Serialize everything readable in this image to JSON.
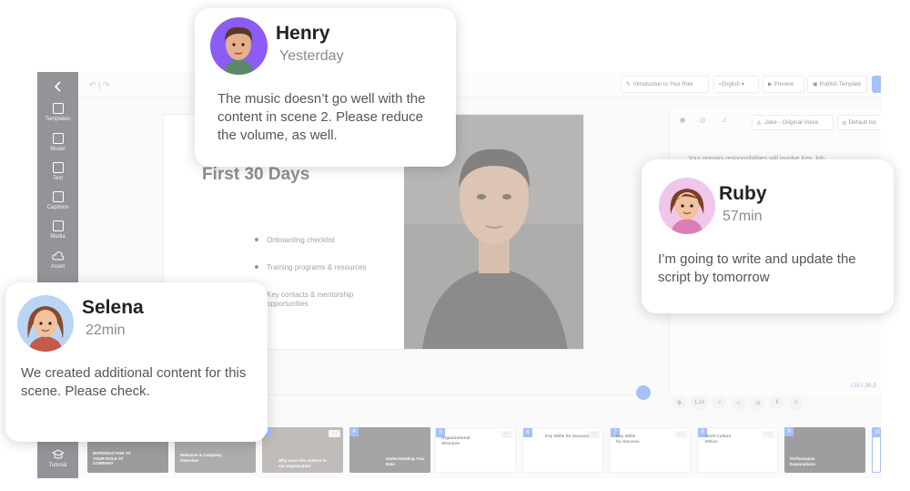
{
  "sidebar": {
    "items": [
      {
        "label": "Templates",
        "icon": "templates-icon"
      },
      {
        "label": "Model",
        "icon": "model-icon"
      },
      {
        "label": "Text",
        "icon": "text-icon"
      },
      {
        "label": "Captions",
        "icon": "captions-icon"
      },
      {
        "label": "Media",
        "icon": "media-icon"
      },
      {
        "label": "Asset",
        "icon": "asset-icon"
      }
    ],
    "tutorial_label": "Tutorial"
  },
  "topbar": {
    "project_title": "Introduction to Your Role",
    "language": "English",
    "preview_label": "Preview",
    "publish_label": "Publish Template"
  },
  "slide": {
    "title": "First 30 Days",
    "bullets": [
      "Onboarding checklist",
      "Training programs & resources",
      "Key contacts & mentorship opportunities"
    ]
  },
  "script_panel": {
    "voice": "Jake - Original Voice",
    "default_label": "Default loc",
    "script_text": "Your primary responsibilities will involve Key Job",
    "char_count": "135",
    "char_limit": "/ 20,0"
  },
  "tools": {
    "speed": "1.1x"
  },
  "scenes": [
    {
      "num": "",
      "title": "INTRODUCTION TO YOUR ROLE AT COMPANY",
      "style": "dark"
    },
    {
      "num": "",
      "title": "Welcome & Company Overview",
      "style": "dark"
    },
    {
      "num": "3",
      "title": "Why your role matters in our organization",
      "style": "dark"
    },
    {
      "num": "4",
      "title": "Understanding Your Role",
      "style": "dark"
    },
    {
      "num": "5",
      "title": "Organizational Structure",
      "style": "light"
    },
    {
      "num": "6",
      "title": "Key Skills for Success",
      "style": "light"
    },
    {
      "num": "7",
      "title": "Key Skills for Success",
      "style": "light"
    },
    {
      "num": "8",
      "title": "Work Culture Ethics",
      "style": "light"
    },
    {
      "num": "9",
      "title": "Performance Expectations",
      "style": "dark"
    },
    {
      "num": "10",
      "title": "",
      "style": "light"
    }
  ],
  "comments": [
    {
      "name": "Henry",
      "time": "Yesterday",
      "message": "The music doesn’t go well with the content in scene 2. Please reduce the volume, as well."
    },
    {
      "name": "Ruby",
      "time": "57min",
      "message": "I’m going to write and update the script by tomorrow"
    },
    {
      "name": "Selena",
      "time": "22min",
      "message": "We created additional content for this scene. Please check."
    }
  ],
  "colors": {
    "accent": "#5d8ff2",
    "sidebar": "#3b3d44",
    "henry_avatar_bg": "#8b5cf6",
    "ruby_avatar_bg": "#f0c7ea",
    "selena_avatar_bg": "#b9d4f5"
  }
}
